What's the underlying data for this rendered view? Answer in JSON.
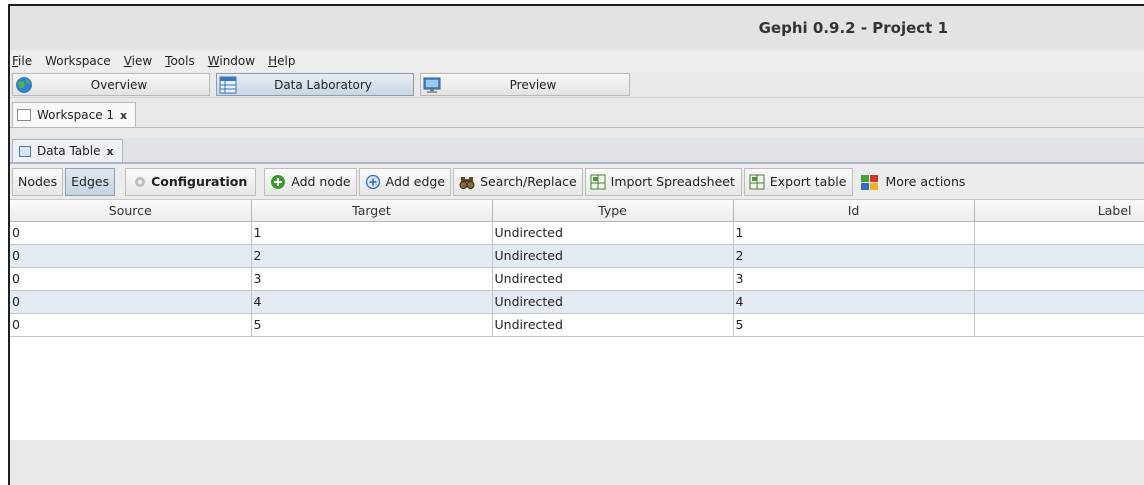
{
  "window": {
    "title": "Gephi 0.9.2 - Project 1"
  },
  "menu": [
    {
      "mnemonic": "F",
      "rest": "ile"
    },
    {
      "mnemonic": "",
      "rest": "Workspace"
    },
    {
      "mnemonic": "V",
      "rest": "iew"
    },
    {
      "mnemonic": "T",
      "rest": "ools"
    },
    {
      "mnemonic": "W",
      "rest": "indow"
    },
    {
      "mnemonic": "H",
      "rest": "elp"
    }
  ],
  "modes": {
    "overview": "Overview",
    "data_laboratory": "Data Laboratory",
    "preview": "Preview",
    "active": "data_laboratory"
  },
  "workspace_tab": {
    "label": "Workspace 1",
    "close": "x"
  },
  "data_table_tab": {
    "label": "Data Table",
    "close": "x"
  },
  "toolbar": {
    "nodes": "Nodes",
    "edges": "Edges",
    "configuration": "Configuration",
    "add_node": "Add node",
    "add_edge": "Add edge",
    "search_replace": "Search/Replace",
    "import_spreadsheet": "Import Spreadsheet",
    "export_table": "Export table",
    "more_actions": "More actions"
  },
  "table": {
    "columns": [
      "Source",
      "Target",
      "Type",
      "Id",
      "Label"
    ],
    "rows": [
      [
        "0",
        "1",
        "Undirected",
        "1",
        ""
      ],
      [
        "0",
        "2",
        "Undirected",
        "2",
        ""
      ],
      [
        "0",
        "3",
        "Undirected",
        "3",
        ""
      ],
      [
        "0",
        "4",
        "Undirected",
        "4",
        ""
      ],
      [
        "0",
        "5",
        "Undirected",
        "5",
        ""
      ]
    ]
  },
  "colors": {
    "selected_row": "#e4ebf4",
    "add_node_icon": "#3b9a2c",
    "add_edge_icon": "#2f6fc0"
  }
}
